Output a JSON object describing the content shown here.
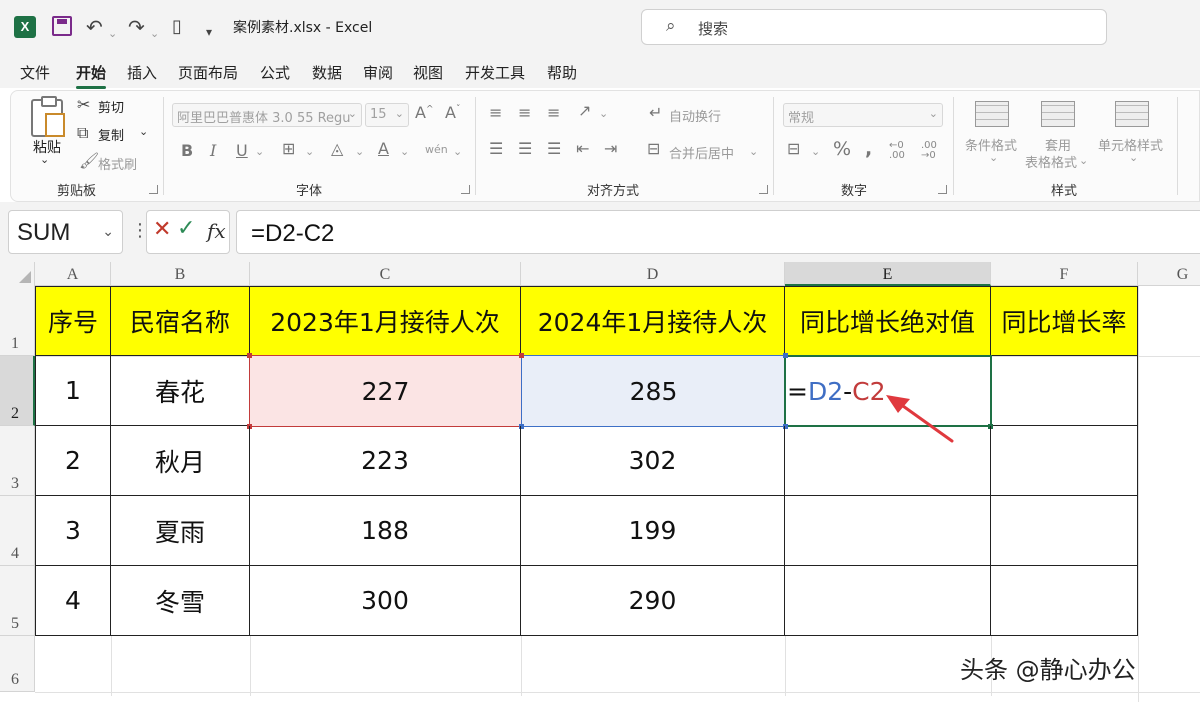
{
  "titlebar": {
    "app_icon_label": "X",
    "doc_title": "案例素材.xlsx  -  Excel",
    "search_placeholder": "搜索"
  },
  "menu": {
    "tabs": [
      {
        "label": "文件"
      },
      {
        "label": "开始"
      },
      {
        "label": "插入"
      },
      {
        "label": "页面布局"
      },
      {
        "label": "公式"
      },
      {
        "label": "数据"
      },
      {
        "label": "审阅"
      },
      {
        "label": "视图"
      },
      {
        "label": "开发工具"
      },
      {
        "label": "帮助"
      }
    ],
    "active": "开始"
  },
  "ribbon": {
    "clipboard": {
      "paste_label": "粘贴",
      "cut_label": "剪切",
      "copy_label": "复制",
      "format_painter_label": "格式刷",
      "group_label": "剪贴板"
    },
    "font": {
      "font_name": "阿里巴巴普惠体 3.0 55 Regu",
      "font_size": "15",
      "group_label": "字体"
    },
    "alignment": {
      "wrap_text_label": "自动换行",
      "merge_center_label": "合并后居中",
      "group_label": "对齐方式"
    },
    "number": {
      "format": "常规",
      "group_label": "数字"
    },
    "styles": {
      "conditional_label": "条件格式",
      "table_label_1": "套用",
      "table_label_2": "表格格式",
      "cell_styles_label": "单元格样式",
      "group_label": "样式"
    }
  },
  "formula_bar": {
    "name_box": "SUM",
    "formula": "=D2-C2"
  },
  "sheet": {
    "columns": [
      "A",
      "B",
      "C",
      "D",
      "E",
      "F",
      "G"
    ],
    "rows": [
      "1",
      "2",
      "3",
      "4",
      "5",
      "6"
    ],
    "selected_column": "E",
    "selected_row": "2",
    "headers": [
      "序号",
      "民宿名称",
      "2023年1月接待人次",
      "2024年1月接待人次",
      "同比增长绝对值",
      "同比增长率"
    ],
    "data": [
      [
        "1",
        "春花",
        "227",
        "285",
        "",
        ""
      ],
      [
        "2",
        "秋月",
        "223",
        "302",
        "",
        ""
      ],
      [
        "3",
        "夏雨",
        "188",
        "199",
        "",
        ""
      ],
      [
        "4",
        "冬雪",
        "300",
        "290",
        "",
        ""
      ]
    ],
    "editing_cell": {
      "eq": "=",
      "ref1": "D2",
      "op": "-",
      "ref2": "C2"
    },
    "colors": {
      "header_fill": "#ffff00",
      "ref_c_color": "#c23b3b",
      "ref_d_color": "#3f6ec4",
      "arrow_color": "#e0393e",
      "select_green": "#1e7145"
    }
  },
  "watermark": "头条 @静心办公"
}
